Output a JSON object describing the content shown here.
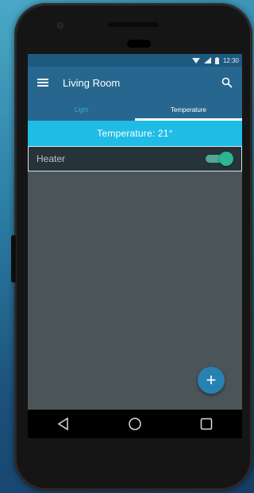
{
  "status_bar": {
    "time": "12:30",
    "icons": [
      "wifi-icon",
      "signal-icon",
      "battery-icon"
    ]
  },
  "app_bar": {
    "title": "Living Room",
    "menu_icon": "menu-icon",
    "search_icon": "search-icon"
  },
  "tabs": [
    {
      "label": "Light",
      "selected": false
    },
    {
      "label": "Temperature",
      "selected": true
    }
  ],
  "temperature": {
    "banner": "Temperature: 21°"
  },
  "devices": [
    {
      "label": "Heater",
      "on": true
    }
  ],
  "fab": {
    "symbol": "+",
    "icon": "add-icon"
  },
  "nav_bar": {
    "icons": [
      "back-icon",
      "home-icon",
      "recents-icon"
    ]
  },
  "colors": {
    "primary": "#27678f",
    "accent": "#1fbde6",
    "switch_on": "#2bb592",
    "fab": "#2682b2"
  }
}
